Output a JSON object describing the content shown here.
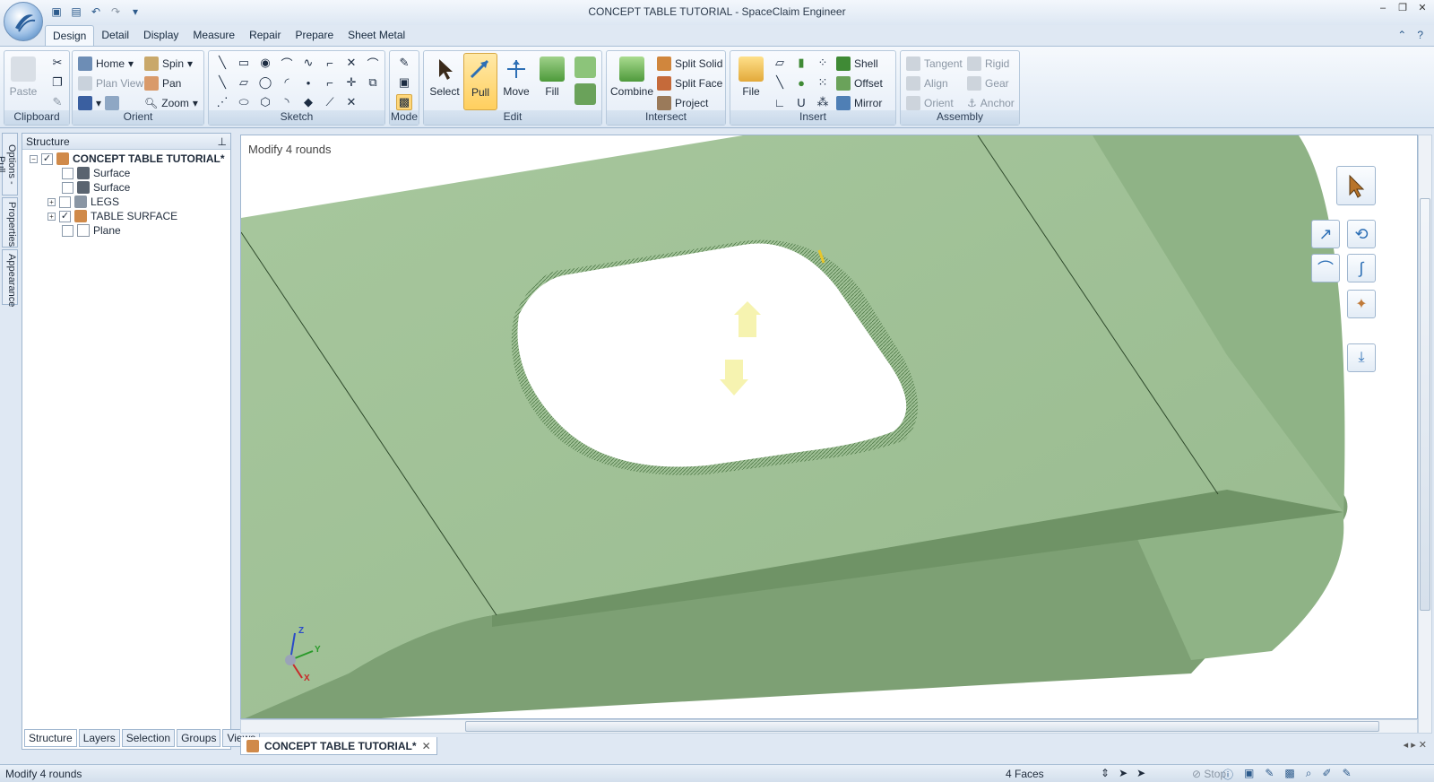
{
  "window": {
    "title": "CONCEPT TABLE TUTORIAL - SpaceClaim Engineer"
  },
  "ribbon_tabs": [
    "Design",
    "Detail",
    "Display",
    "Measure",
    "Repair",
    "Prepare",
    "Sheet Metal"
  ],
  "ribbon": {
    "clipboard": {
      "label": "Clipboard",
      "paste": "Paste"
    },
    "orient": {
      "label": "Orient",
      "home": "Home",
      "spin": "Spin",
      "plan_view": "Plan View",
      "pan": "Pan",
      "zoom": "Zoom"
    },
    "sketch": {
      "label": "Sketch"
    },
    "mode": {
      "label": "Mode"
    },
    "edit": {
      "label": "Edit",
      "select": "Select",
      "pull": "Pull",
      "move": "Move",
      "fill": "Fill"
    },
    "intersect": {
      "label": "Intersect",
      "combine": "Combine",
      "split_solid": "Split Solid",
      "split_face": "Split Face",
      "project": "Project"
    },
    "insert": {
      "label": "Insert",
      "file": "File",
      "shell": "Shell",
      "offset": "Offset",
      "mirror": "Mirror"
    },
    "assembly": {
      "label": "Assembly",
      "tangent": "Tangent",
      "rigid": "Rigid",
      "align": "Align",
      "gear": "Gear",
      "orient": "Orient",
      "anchor": "Anchor"
    }
  },
  "side_tabs": [
    "Options - Pull",
    "Properties",
    "Appearance"
  ],
  "structure": {
    "header": "Structure",
    "items": [
      {
        "label": "CONCEPT TABLE TUTORIAL*"
      },
      {
        "label": "Surface"
      },
      {
        "label": "Surface"
      },
      {
        "label": "LEGS"
      },
      {
        "label": "TABLE SURFACE"
      },
      {
        "label": "Plane"
      }
    ],
    "tabs": [
      "Structure",
      "Layers",
      "Selection",
      "Groups",
      "Views"
    ]
  },
  "viewport": {
    "operation_label": "Modify 4 rounds",
    "axis_labels": {
      "x": "X",
      "y": "Y",
      "z": "Z"
    },
    "model_color": "#9dbf95"
  },
  "document_tab": {
    "label": "CONCEPT TABLE TUTORIAL*"
  },
  "status": {
    "message": "Modify 4 rounds",
    "selection": "4 Faces",
    "stop": "Stop"
  }
}
